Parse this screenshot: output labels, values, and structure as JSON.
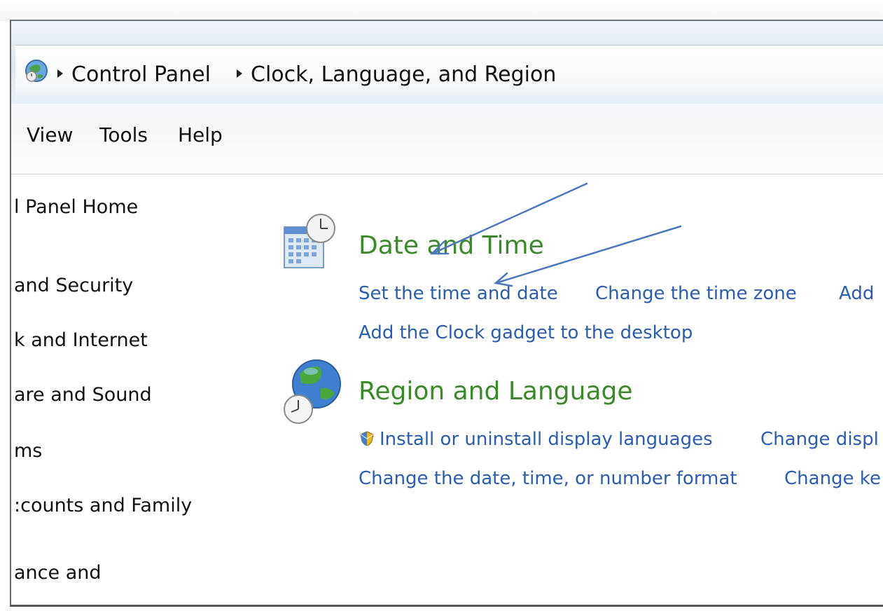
{
  "address_bar": {
    "crumbs": [
      "Control Panel",
      "Clock, Language, and Region"
    ]
  },
  "menu": {
    "items": [
      "View",
      "Tools",
      "Help"
    ]
  },
  "sidebar": {
    "items": [
      "l Panel Home",
      "and Security",
      "k and Internet",
      "are and Sound",
      "ms",
      ":counts and Family",
      "ance and"
    ]
  },
  "categories": [
    {
      "title": "Date and Time",
      "icon": "calendar-clock-icon",
      "links_row1": [
        "Set the time and date",
        "Change the time zone",
        "Add"
      ],
      "links_row2": [
        "Add the Clock gadget to the desktop"
      ]
    },
    {
      "title": "Region and Language",
      "icon": "globe-clock-icon",
      "links_row1": [
        "Install or uninstall display languages",
        "Change displ"
      ],
      "links_row2": [
        "Change the date, time, or number format",
        "Change ke"
      ]
    }
  ],
  "colors": {
    "link": "#2a5db0",
    "category_title": "#3a8a2a",
    "annotation_arrow": "#4a78c0"
  }
}
